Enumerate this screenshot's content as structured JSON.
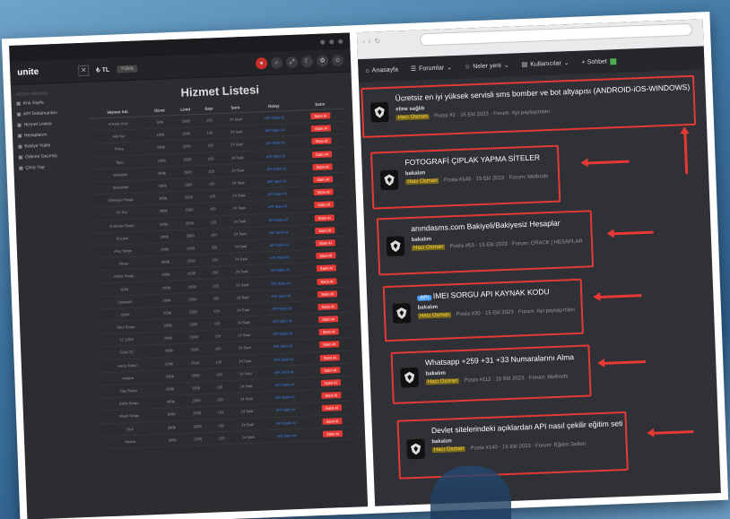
{
  "left": {
    "logo": "unite",
    "tl_label": "₺ TL",
    "tl_pill": "Yükle",
    "title": "Hizmet Listesi",
    "sidebar_header": "HESAP MENÜSÜ",
    "sidebar": [
      "Ana Sayfa",
      "API Dokümanları",
      "Hizmet Listesi",
      "Hesaplarım",
      "Bakiye Yükle",
      "Ödeme Geçmişi",
      "Çıkış Yap"
    ],
    "columns": [
      "Hizmet Adı",
      "Ücret",
      "Limit",
      "Sayi",
      "Sure",
      "Detay",
      "Satın"
    ],
    "rows": [
      [
        "Ankara Hızlı",
        "50₺",
        "2500",
        "150",
        "24 Saat",
        "API Satın Al",
        "Satın Al"
      ],
      [
        "Aile Bul",
        "100₺",
        "2500",
        "150",
        "24 Saat",
        "API Satın Al",
        "Satın Al"
      ],
      [
        "Plaka",
        "200₺",
        "2500",
        "150",
        "24 Saat",
        "API Satın Al",
        "Satın Al"
      ],
      [
        "Tapu",
        "150₺",
        "2500",
        "150",
        "24 Saat",
        "API Satın Al",
        "Satın Al"
      ],
      [
        "Vesikalık",
        "400₺",
        "2500",
        "150",
        "24 Saat",
        "API Satın Al",
        "Satın Al"
      ],
      [
        "Şikayetler",
        "400₺",
        "2500",
        "150",
        "24 Saat",
        "API Satın Al",
        "Satın Al"
      ],
      [
        "Ebeveyn Sorgu",
        "300₺",
        "2500",
        "150",
        "24 Saat",
        "API Satın Al",
        "Satın Al"
      ],
      [
        "TC Pro",
        "300₺",
        "2500",
        "150",
        "24 Saat",
        "API Satın Al",
        "Satın Al"
      ],
      [
        "E-Devlet Sorgu",
        "500₺",
        "2500",
        "150",
        "24 Saat",
        "API Satın Al",
        "Satın Al"
      ],
      [
        "Eczane",
        "200₺",
        "2500",
        "150",
        "24 Saat",
        "API Satın Al",
        "Satın Al"
      ],
      [
        "Araç Sorgu",
        "200₺",
        "2500",
        "250",
        "24 Saat",
        "API Satın Al",
        "Satın Al"
      ],
      [
        "Sorgu",
        "300₺",
        "2500",
        "150",
        "24 Saat",
        "API Satın Al",
        "Satın Al"
      ],
      [
        "Adres Sorgu",
        "200₺",
        "2500",
        "250",
        "24 Saat",
        "API Satın Al",
        "Satın Al"
      ],
      [
        "GSM",
        "200₺",
        "2500",
        "150",
        "24 Saat",
        "API Satın Al",
        "Satın Al"
      ],
      [
        "Operatör",
        "200₺",
        "2500",
        "250",
        "24 Saat",
        "API Satın Al",
        "Satın Al"
      ],
      [
        "IBAN",
        "200₺",
        "2500",
        "150",
        "24 Saat",
        "API Satın Al",
        "Satın Al"
      ],
      [
        "Okul Sorgu",
        "200₺",
        "2500",
        "150",
        "24 Saat",
        "API Satın Al",
        "Satın Al"
      ],
      [
        "TC GSM",
        "200₺",
        "2500",
        "150",
        "24 Saat",
        "API Satın Al",
        "Satın Al"
      ],
      [
        "GSM TC",
        "200₺",
        "2500",
        "150",
        "24 Saat",
        "API Satın Al",
        "Satın Al"
      ],
      [
        "Hane Sorgu",
        "200₺",
        "2500",
        "150",
        "24 Saat",
        "API Satın Al",
        "Satın Al"
      ],
      [
        "Akraba",
        "200₺",
        "2500",
        "150",
        "24 Saat",
        "API Satın Al",
        "Satın Al"
      ],
      [
        "Tapı Sorgu",
        "200₺",
        "2500",
        "150",
        "24 Saat",
        "API Satın Al",
        "Satın Al"
      ],
      [
        "Gebe Sorgu",
        "400₺",
        "2500",
        "150",
        "24 Saat",
        "API Satın Al",
        "Satın Al"
      ],
      [
        "Nikah Sorgu",
        "300₺",
        "2500",
        "150",
        "24 Saat",
        "API Satın Al",
        "Satın Al"
      ],
      [
        "Sicil",
        "300₺",
        "2500",
        "150",
        "24 Saat",
        "API Satın Al",
        "Satın Al"
      ],
      [
        "Mernis",
        "300₺",
        "2500",
        "150",
        "24 Saat",
        "API Satın Al",
        "Satın Al"
      ]
    ]
  },
  "right": {
    "nav": {
      "home": "Anasayfa",
      "forums": "Forumlar",
      "whats_new": "Neler yeni",
      "members": "Kullanıcılar",
      "chat": "+ Sohbet"
    },
    "threads": [
      {
        "title": "Ücretsiz en iyi yüksek servisli sms bomber ve bot altyapısı (ANDROID-iOS-WINDOWS)",
        "user": "eline sağlık",
        "author": "Hacı Osman",
        "meta": " · Posta #2 · 16 Ekl 2023 · Forum: Api paylaşımları",
        "tag": ""
      },
      {
        "title": "FOTOGRAFİ ÇIPLAK YAPMA SİTELER",
        "user": "bakalım",
        "author": "Hacı Osman",
        "meta": " · Posta #145 · 15 Ekl 2023 · Forum: Methods",
        "tag": ""
      },
      {
        "title": "anındasms.com Bakiyeli/Bakiyesiz Hesaplar",
        "user": "bakalım",
        "author": "Hacı Osman",
        "meta": " · Posta #53 · 15 Ekl 2023 · Forum: CRACK | HESAPLAR",
        "tag": ""
      },
      {
        "title": "IMEI SORGU API KAYNAK KODU",
        "user": "bakalım",
        "author": "Hacı Osman",
        "meta": " · Posta #30 · 15 Ekl 2023 · Forum: Api paylaşımları",
        "tag": "API"
      },
      {
        "title": "Whatsapp +259 +31 +33 Numaralarını Alma",
        "user": "bakalım",
        "author": "Hacı Osman",
        "meta": " · Posta #112 · 15 Ekl 2023 · Forum: Methods",
        "tag": ""
      },
      {
        "title": "Devlet sitelerindeki açıklardan API nasıl çekilir eğitim seti",
        "user": "bakalım",
        "author": "Hacı Osman",
        "meta": " · Posta #140 · 15 Ekl 2023 · Forum: Eğitim Setleri",
        "tag": ""
      }
    ]
  },
  "colors": {
    "accent_red": "#e53935",
    "link_blue": "#3b82f6",
    "highlight": "#ffd54a"
  }
}
